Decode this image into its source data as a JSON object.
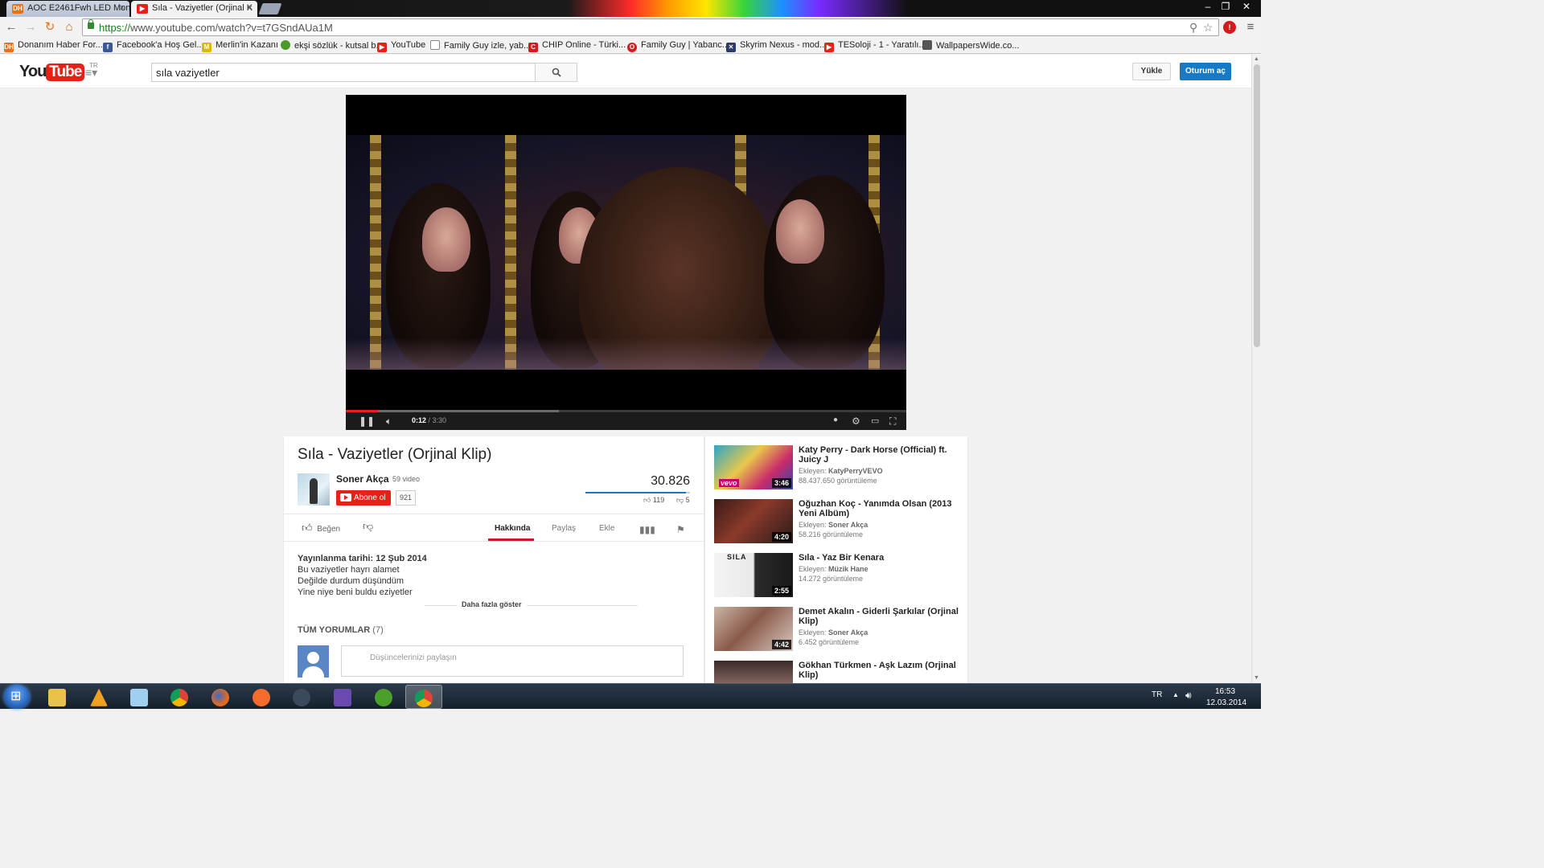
{
  "browser": {
    "tabs": [
      {
        "label": "AOC E2461Fwh LED Monit",
        "favicon": "DH"
      },
      {
        "label": "Sıla - Vaziyetler (Orjinal K",
        "favicon": "youtube-icon"
      }
    ],
    "url_scheme": "https://",
    "url_rest": "www.youtube.com/watch?v=t7GSndAUa1M",
    "bookmarks": [
      {
        "label": "Donanım Haber For...",
        "icon": "DH"
      },
      {
        "label": "Facebook'a Hoş Gel...",
        "icon": "facebook-icon"
      },
      {
        "label": "Merlin'in Kazanı",
        "icon": "merlin-icon"
      },
      {
        "label": "ekşi sözlük - kutsal b...",
        "icon": "eksi-icon"
      },
      {
        "label": "YouTube",
        "icon": "youtube-icon"
      },
      {
        "label": "Family Guy izle, yab...",
        "icon": "page-icon"
      },
      {
        "label": "CHIP Online - Türki...",
        "icon": "chip-icon"
      },
      {
        "label": "Family Guy | Yabanc...",
        "icon": "opera-icon"
      },
      {
        "label": "Skyrim Nexus - mod...",
        "icon": "nexus-icon"
      },
      {
        "label": "TESoloji - 1 - Yaratılı...",
        "icon": "youtube-icon"
      },
      {
        "label": "WallpapersWide.co...",
        "icon": "wallpaper-icon"
      }
    ]
  },
  "youtube": {
    "logo_you": "You",
    "logo_tube": "Tube",
    "logo_region": "TR",
    "search_value": "sıla vaziyetler",
    "upload_label": "Yükle",
    "signin_label": "Oturum aç"
  },
  "player": {
    "current_time": "0:12",
    "duration": " / 3:30",
    "played_fraction": 0.057,
    "buffered_fraction": 0.38
  },
  "video": {
    "title": "Sıla - Vaziyetler (Orjinal Klip)",
    "channel": "Soner Akça",
    "channel_videos": "59 video",
    "subscribe_label": "Abone ol",
    "subscriber_count": "921",
    "views": "30.826",
    "likes": "119",
    "dislikes": "5",
    "like_label": "Beğen",
    "tabs": [
      "Hakkında",
      "Paylaş",
      "Ekle"
    ],
    "publish_date": "Yayınlanma tarihi: 12 Şub 2014",
    "description": [
      "Bu vaziyetler hayrı alamet",
      "Değilde durdum düşündüm",
      "Yine niye beni buldu eziyetler"
    ],
    "show_more": "Daha fazla göster",
    "comments_title": "TÜM YORUMLAR",
    "comments_count": "(7)",
    "comment_placeholder": "Düşüncelerinizi paylaşın"
  },
  "related": [
    {
      "title": "Katy Perry - Dark Horse (Official) ft. Juicy J",
      "uploader_prefix": "Ekleyen: ",
      "uploader": "KatyPerryVEVO",
      "views": "88.437.650 görüntüleme",
      "duration": "3:46",
      "badge": "vevo"
    },
    {
      "title": "Oğuzhan Koç - Yanımda Olsan (2013 Yeni Albüm)",
      "uploader_prefix": "Ekleyen: ",
      "uploader": "Soner Akça",
      "views": "58.216 görüntüleme",
      "duration": "4:20",
      "badge": ""
    },
    {
      "title": "Sıla - Yaz Bir Kenara",
      "uploader_prefix": "Ekleyen: ",
      "uploader": "Müzik Hane",
      "views": "14.272 görüntüleme",
      "duration": "2:55",
      "badge": "SILA"
    },
    {
      "title": "Demet Akalın - Giderli Şarkılar (Orjinal Klip)",
      "uploader_prefix": "Ekleyen: ",
      "uploader": "Soner Akça",
      "views": "6.452 görüntüleme",
      "duration": "4:42",
      "badge": ""
    },
    {
      "title": "Gökhan Türkmen - Aşk Lazım (Orjinal Klip)",
      "uploader_prefix": "",
      "uploader": "",
      "views": "",
      "duration": "",
      "badge": ""
    }
  ],
  "taskbar": {
    "apps": [
      "windows-explorer-icon",
      "vlc-icon",
      "notepad-icon",
      "chrome-icon",
      "firefox-icon",
      "origin-icon",
      "steam-icon",
      "visual-studio-icon",
      "utorrent-icon",
      "chrome-icon"
    ],
    "language": "TR",
    "time": "16:53",
    "date": "12.03.2014"
  },
  "colors": {
    "youtube_red": "#e62117",
    "signin_blue": "#167ac6",
    "tab_active_red": "#cc181e"
  }
}
